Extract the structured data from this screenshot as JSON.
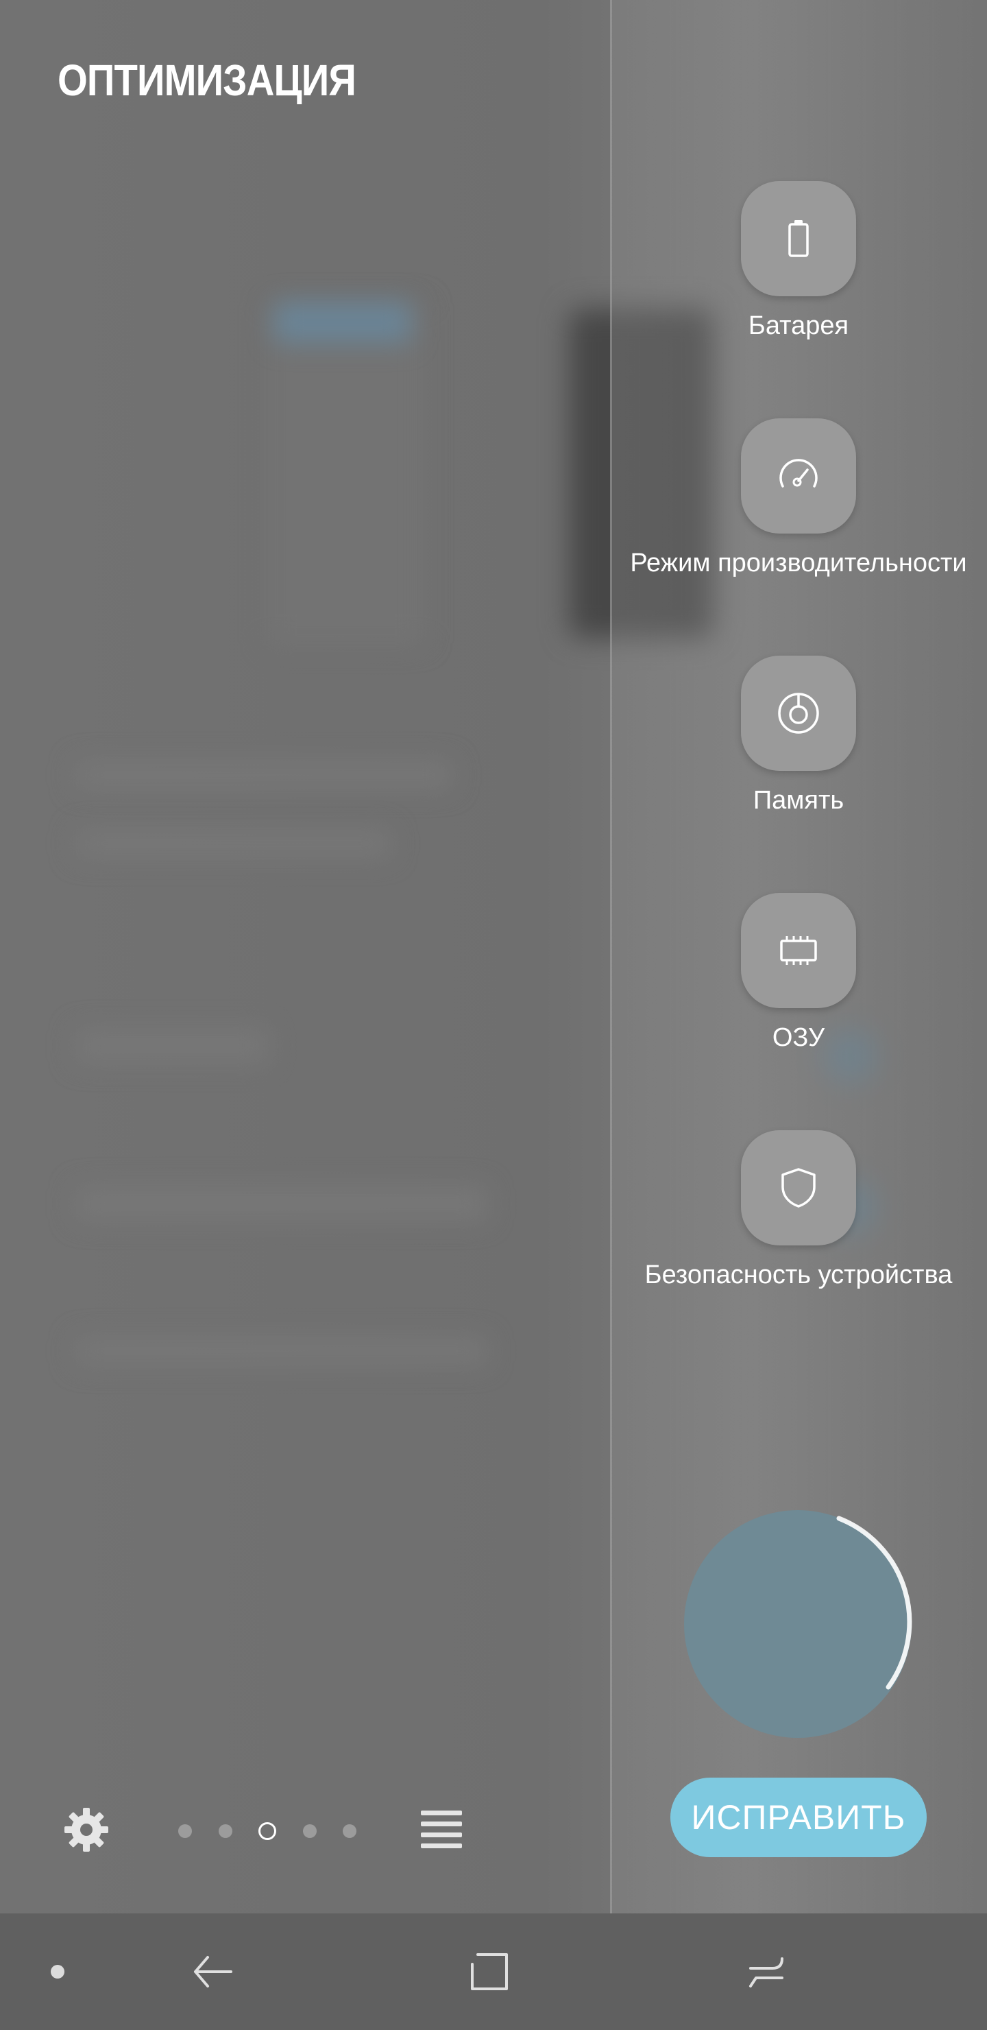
{
  "header": {
    "title": "ОПТИМИЗАЦИЯ"
  },
  "tools": [
    {
      "label": "Батарея",
      "icon": "battery-icon"
    },
    {
      "label": "Режим производительности",
      "icon": "speedometer-icon"
    },
    {
      "label": "Память",
      "icon": "storage-icon"
    },
    {
      "label": "ОЗУ",
      "icon": "memory-chip-icon"
    },
    {
      "label": "Безопасность устройства",
      "icon": "shield-icon"
    }
  ],
  "actions": {
    "fix_label": "ИСПРАВИТЬ"
  },
  "pager": {
    "count": 5,
    "active_index": 2
  },
  "colors": {
    "accent": "#7ec9e0",
    "tool_button": "#9a9a9a",
    "scan_circle": "#6f8a95",
    "nav_bar": "#606060"
  }
}
